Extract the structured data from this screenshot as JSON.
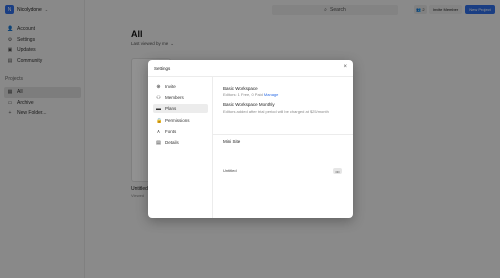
{
  "workspace": {
    "name": "Nicolydone",
    "initial": "N"
  },
  "sidebar": {
    "items": [
      {
        "label": "Account",
        "icon": "person-icon"
      },
      {
        "label": "Settings",
        "icon": "gear-icon"
      },
      {
        "label": "Updates",
        "icon": "bell-icon"
      },
      {
        "label": "Community",
        "icon": "chat-icon"
      }
    ],
    "projects_heading": "Projects",
    "project_items": [
      {
        "label": "All",
        "icon": "grid-icon"
      },
      {
        "label": "Archive",
        "icon": "archive-icon"
      },
      {
        "label": "New Folder...",
        "icon": "plus-icon"
      }
    ]
  },
  "topbar": {
    "search_label": "Search",
    "people_count": "2",
    "invite_label": "Invite Member",
    "new_project_label": "New Project"
  },
  "main": {
    "title": "All",
    "sort_label": "Last viewed by me",
    "card_title": "Untitled",
    "card_sub": "Viewed"
  },
  "modal": {
    "title": "Settings",
    "nav": [
      {
        "label": "Invite",
        "icon": "invite-icon"
      },
      {
        "label": "Members",
        "icon": "members-icon"
      },
      {
        "label": "Plans",
        "icon": "plans-icon"
      },
      {
        "label": "Permissions",
        "icon": "lock-icon"
      },
      {
        "label": "Fonts",
        "icon": "fonts-icon"
      },
      {
        "label": "Details",
        "icon": "details-icon"
      }
    ],
    "plan": {
      "name": "Basic Workspace",
      "details": "Editors: 1 Free, 0 Paid",
      "manage_label": "Manage",
      "monthly_heading": "Basic Workspace Monthly",
      "monthly_text": "Editors added after trial period will be charged at $25/month"
    },
    "minisite": {
      "heading": "Mini Site",
      "value": "Untitled",
      "menu_label": "•••"
    }
  },
  "colors": {
    "accent": "#2e6ee6"
  }
}
